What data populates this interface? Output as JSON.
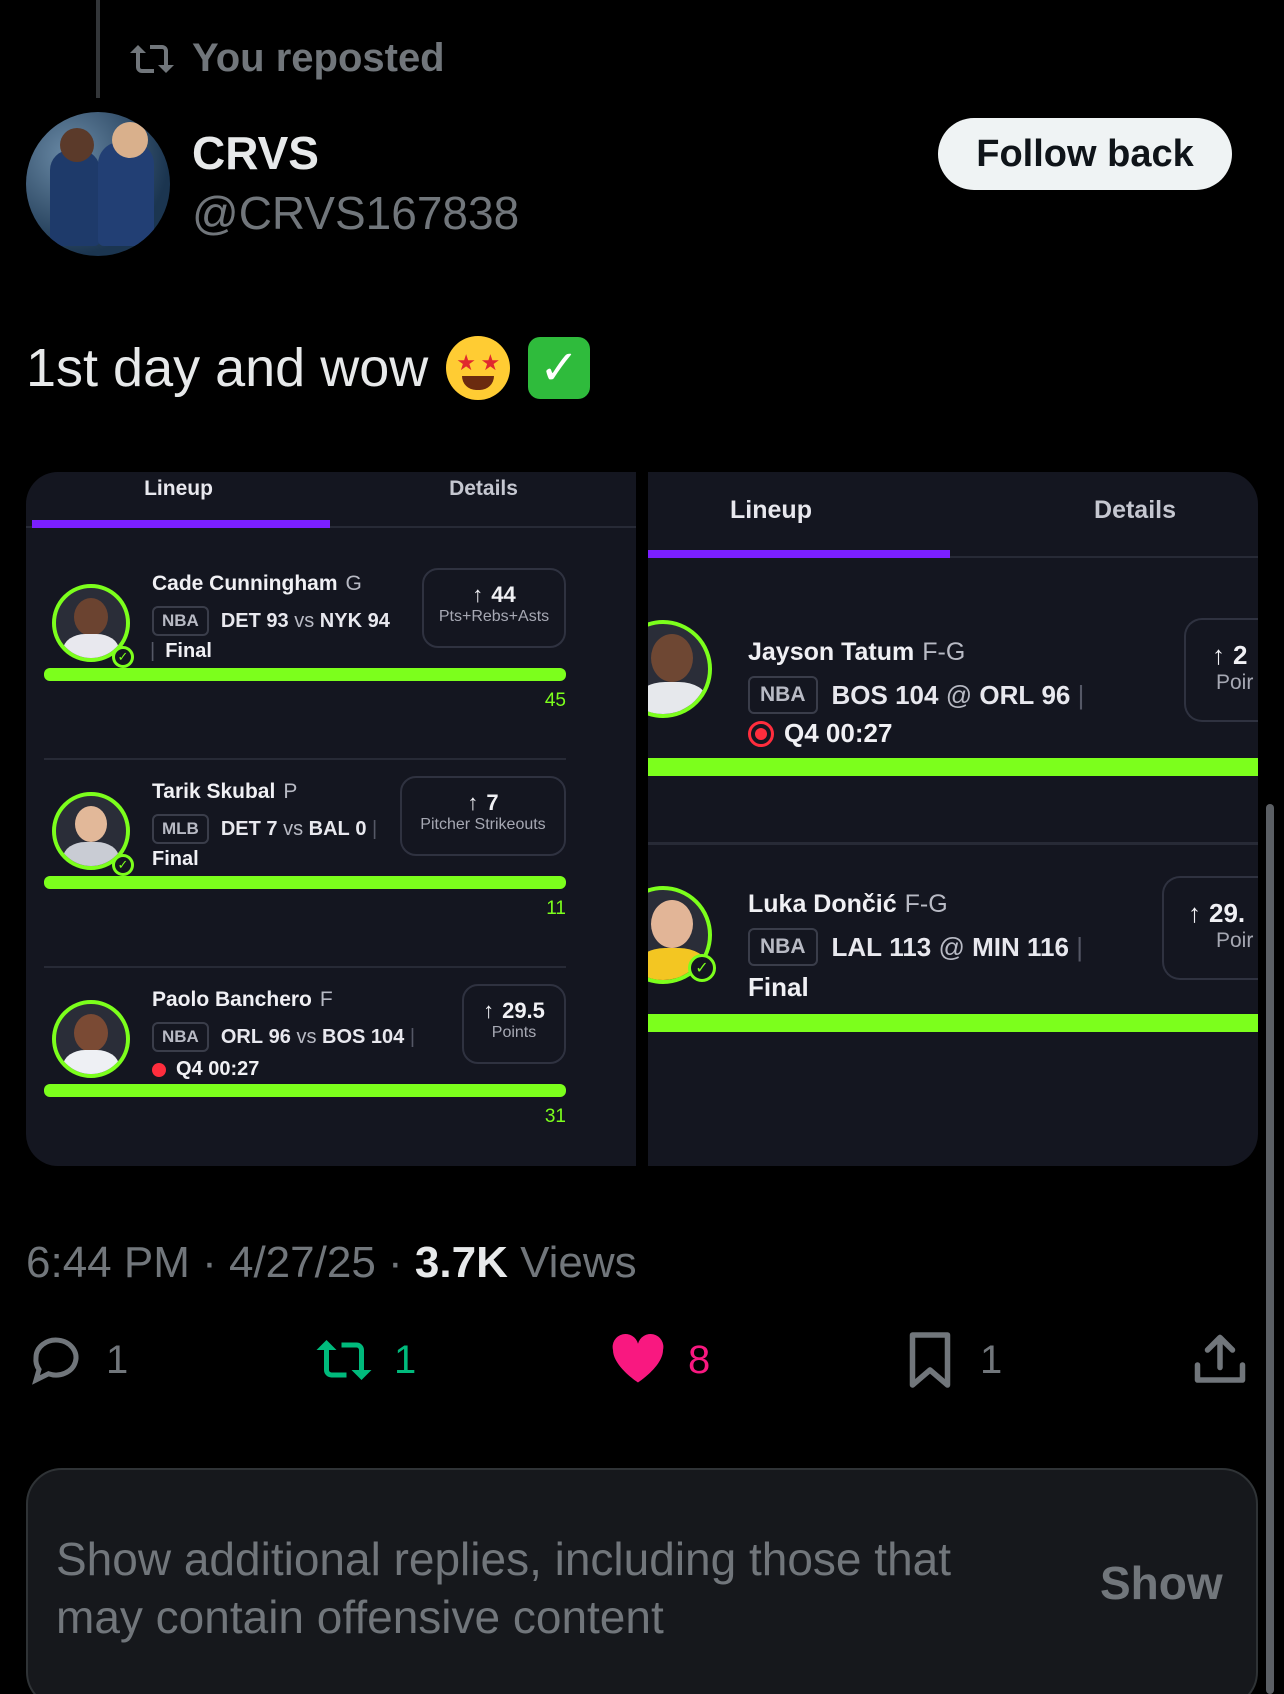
{
  "repost": {
    "label": "You reposted"
  },
  "author": {
    "name": "CRVS",
    "handle": "@CRVS167838",
    "follow_label": "Follow back"
  },
  "post": {
    "text": "1st day and wow",
    "emojis": [
      "star-struck-emoji",
      "check-mark-emoji"
    ]
  },
  "media": {
    "left": {
      "tabs": [
        "Lineup",
        "Details"
      ],
      "picks": [
        {
          "name": "Cade Cunningham",
          "pos": "G",
          "league": "NBA",
          "team1": "DET",
          "score1": "93",
          "vs": "vs",
          "team2": "NYK",
          "score2": "94",
          "status": "Final",
          "stat_value": "44",
          "stat_label": "Pts+Rebs+Asts",
          "result": "45",
          "progress": 1.0
        },
        {
          "name": "Tarik Skubal",
          "pos": "P",
          "league": "MLB",
          "team1": "DET",
          "score1": "7",
          "vs": "vs",
          "team2": "BAL",
          "score2": "0",
          "status": "Final",
          "stat_value": "7",
          "stat_label": "Pitcher Strikeouts",
          "result": "11",
          "progress": 1.0
        },
        {
          "name": "Paolo Banchero",
          "pos": "F",
          "league": "NBA",
          "team1": "ORL",
          "score1": "96",
          "vs": "vs",
          "team2": "BOS",
          "score2": "104",
          "status": "Q4 00:27",
          "stat_value": "29.5",
          "stat_label": "Points",
          "result": "31",
          "progress": 1.0
        }
      ]
    },
    "right": {
      "tabs": [
        "Lineup",
        "Details"
      ],
      "picks": [
        {
          "name": "Jayson Tatum",
          "pos": "F-G",
          "league": "NBA",
          "team1": "BOS",
          "score1": "104",
          "vs": "@",
          "team2": "ORL",
          "score2": "96",
          "status": "Q4 00:27",
          "stat_value": "2",
          "stat_label": "Poir",
          "progress": 1.0
        },
        {
          "name": "Luka Dončić",
          "pos": "F-G",
          "league": "NBA",
          "team1": "LAL",
          "score1": "113",
          "vs": "@",
          "team2": "MIN",
          "score2": "116",
          "status": "Final",
          "stat_value": "29.",
          "stat_label": "Poir",
          "progress": 1.0
        }
      ]
    }
  },
  "meta": {
    "time": "6:44 PM",
    "date": "4/27/25",
    "views_count": "3.7K",
    "views_label": "Views"
  },
  "actions": {
    "replies": "1",
    "reposts": "1",
    "likes": "8",
    "bookmarks": "1"
  },
  "colors": {
    "repost_active": "#00ba7c",
    "like_active": "#f91880",
    "accent_green": "#7cff1c",
    "tab_purple": "#7b1fff"
  },
  "more_replies": {
    "text": "Show additional replies, including those that may contain offensive content",
    "button": "Show"
  }
}
